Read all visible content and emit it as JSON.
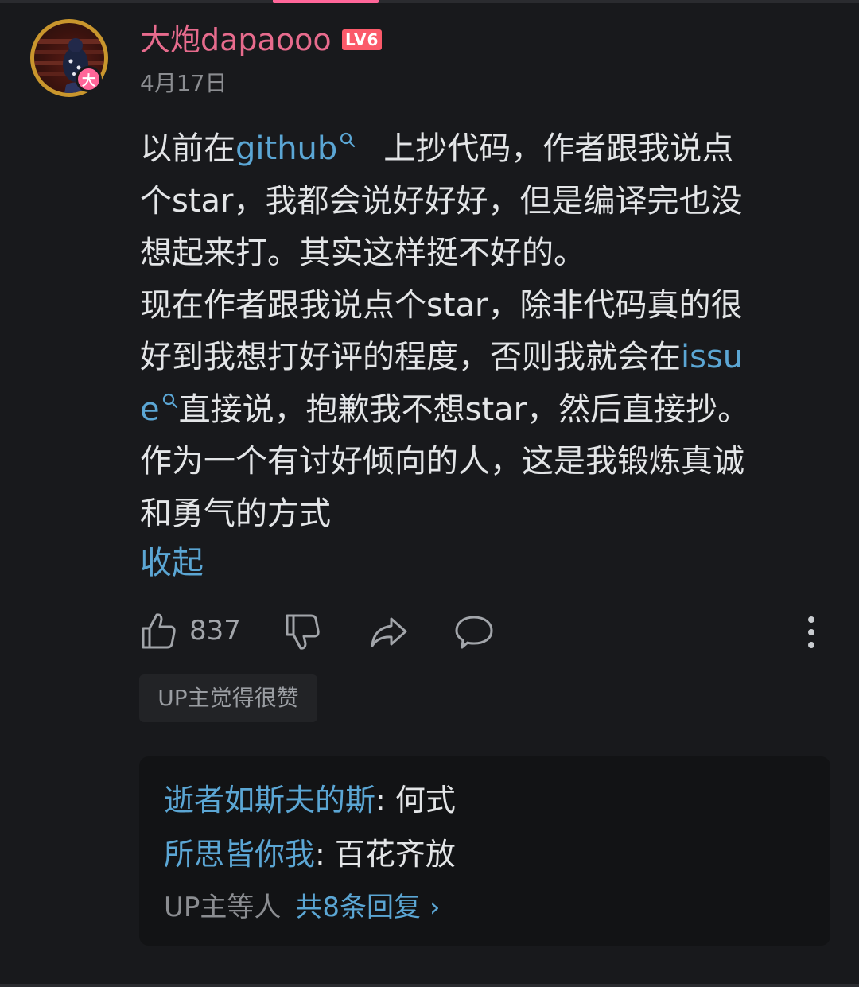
{
  "user": {
    "name": "大炮dapaooo",
    "level": "LV6",
    "avatar_badge": "大",
    "date": "4月17日"
  },
  "comment": {
    "lines": [
      {
        "pre": "以前在",
        "link": "github",
        "post": "上抄代码，作者跟我说点"
      },
      {
        "text": "个star，我都会说好好好，但是编译完也没"
      },
      {
        "text": "想起来打。其实这样挺不好的。"
      },
      {
        "text": "现在作者跟我说点个star，除非代码真的很"
      },
      {
        "pre": "好到我想打好评的程度，否则我就会在",
        "link": "issu"
      },
      {
        "link": "e",
        "post": "直接说，抱歉我不想star，然后直接抄。"
      },
      {
        "text": "作为一个有讨好倾向的人，这是我锻炼真诚"
      },
      {
        "text": "和勇气的方式"
      }
    ],
    "collapse_label": "收起"
  },
  "actions": {
    "like_count": "837",
    "icons": [
      "thumbs-up-icon",
      "thumbs-down-icon",
      "share-icon",
      "comment-icon",
      "more-icon"
    ]
  },
  "up_tag": "UP主觉得很赞",
  "replies": {
    "items": [
      {
        "user": "逝者如斯夫的斯",
        "text": ": 何式"
      },
      {
        "user": "所思皆你我",
        "text": ": 百花齐放"
      }
    ],
    "up_others": "UP主等人",
    "count_label": "共8条回复 ›"
  },
  "colors": {
    "background": "#18191c",
    "link": "#5ba6d4",
    "username": "#e76b8d",
    "level_badge": "#fb5a6a",
    "indicator": "#ff6699"
  }
}
